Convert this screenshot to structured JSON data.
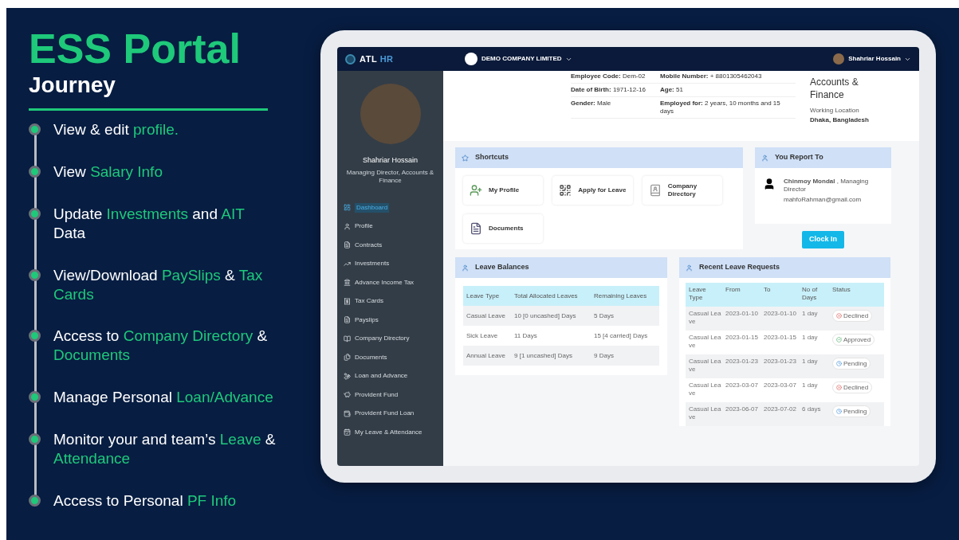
{
  "slide": {
    "title": "ESS Portal",
    "subtitle": "Journey"
  },
  "journey": [
    {
      "parts": [
        {
          "text": "View & edit ",
          "accent": false
        },
        {
          "text": "profile.",
          "accent": true
        }
      ]
    },
    {
      "parts": [
        {
          "text": "View ",
          "accent": false
        },
        {
          "text": "Salary Info",
          "accent": true
        }
      ]
    },
    {
      "parts": [
        {
          "text": "Update ",
          "accent": false
        },
        {
          "text": "Investments",
          "accent": true
        },
        {
          "text": " and ",
          "accent": false
        },
        {
          "text": "AIT",
          "accent": true
        },
        {
          "text": " Data",
          "accent": false
        }
      ]
    },
    {
      "parts": [
        {
          "text": "View/Download ",
          "accent": false
        },
        {
          "text": "PaySlips",
          "accent": true
        },
        {
          "text": " & ",
          "accent": false
        },
        {
          "text": "Tax Cards",
          "accent": true
        }
      ]
    },
    {
      "parts": [
        {
          "text": "Access to ",
          "accent": false
        },
        {
          "text": "Company Directory",
          "accent": true
        },
        {
          "text": " & ",
          "accent": false
        },
        {
          "text": "Documents",
          "accent": true
        }
      ]
    },
    {
      "parts": [
        {
          "text": "Manage Personal ",
          "accent": false
        },
        {
          "text": "Loan/Advance",
          "accent": true
        }
      ]
    },
    {
      "parts": [
        {
          "text": "Monitor your and team’s ",
          "accent": false
        },
        {
          "text": "Leave",
          "accent": true
        },
        {
          "text": " & ",
          "accent": false
        },
        {
          "text": "Attendance",
          "accent": true
        }
      ]
    },
    {
      "parts": [
        {
          "text": "Access to Personal ",
          "accent": false
        },
        {
          "text": "PF Info",
          "accent": true
        }
      ]
    }
  ],
  "app": {
    "logo": [
      {
        "text": "ATL ",
        "accent": false
      },
      {
        "text": "HR",
        "accent": true
      }
    ],
    "company": "DEMO COMPANY LIMITED",
    "user": "Shahriar Hossain",
    "sidebar": {
      "name": "Shahriar Hossain",
      "role": "Managing Director, Accounts & Finance",
      "items": [
        {
          "label": "Dashboard",
          "selected": true
        },
        {
          "label": "Profile",
          "selected": false
        },
        {
          "label": "Contracts",
          "selected": false
        },
        {
          "label": "Investments",
          "selected": false
        },
        {
          "label": "Advance Income Tax",
          "selected": false
        },
        {
          "label": "Tax Cards",
          "selected": false
        },
        {
          "label": "Payslips",
          "selected": false
        },
        {
          "label": "Company Directory",
          "selected": false
        },
        {
          "label": "Documents",
          "selected": false
        },
        {
          "label": "Loan and Advance",
          "selected": false
        },
        {
          "label": "Provident Fund",
          "selected": false
        },
        {
          "label": "Provident Fund Loan",
          "selected": false
        },
        {
          "label": "My Leave & Attendance",
          "selected": false
        }
      ]
    },
    "profile": {
      "fields": [
        {
          "label": "Employee Code:",
          "value": "Dem-02"
        },
        {
          "label": "Mobile Number:",
          "value": "+ 8801305462043"
        },
        {
          "label": "Date of Birth:",
          "value": "1971-12-16"
        },
        {
          "label": "Age:",
          "value": "51"
        },
        {
          "label": "Gender:",
          "value": "Male"
        },
        {
          "label": "Employed for:",
          "value": "2 years, 10 months and 15 days"
        }
      ],
      "department": "Accounts & Finance",
      "location_label": "Working Location",
      "location": "Dhaka, Bangladesh"
    },
    "shortcuts": {
      "title": "Shortcuts",
      "items": [
        "My Profile",
        "Apply for Leave",
        "Company Directory",
        "Documents"
      ]
    },
    "report_to": {
      "title": "You Report To",
      "name": "Chinmoy Mondal",
      "role": ", Managing Director",
      "email": "mahfoRahman@gmail.com"
    },
    "clock_in": "Clock In",
    "leave_balances": {
      "title": "Leave Balances",
      "columns": [
        "Leave Type",
        "Total Allocated Leaves",
        "Remaining Leaves"
      ],
      "rows": [
        [
          "Casual Leave",
          "10 [0 uncashed] Days",
          "5 Days"
        ],
        [
          "Sick Leave",
          "11 Days",
          "15 [4 carried] Days"
        ],
        [
          "Annual Leave",
          "9 [1 uncashed] Days",
          "9 Days"
        ]
      ]
    },
    "recent_requests": {
      "title": "Recent Leave Requests",
      "columns": [
        "Leave Type",
        "From",
        "To",
        "No of Days",
        "Status"
      ],
      "rows": [
        {
          "cells": [
            "Casual Leave",
            "2023-01-10",
            "2023-01-10",
            "1 day"
          ],
          "status": {
            "label": "Declined",
            "kind": "declined"
          }
        },
        {
          "cells": [
            "Casual Leave",
            "2023-01-15",
            "2023-01-15",
            "1 day"
          ],
          "status": {
            "label": "Approved",
            "kind": "approved"
          }
        },
        {
          "cells": [
            "Casual Leave",
            "2023-01-23",
            "2023-01-23",
            "1 day"
          ],
          "status": {
            "label": "Pending",
            "kind": "pending"
          }
        },
        {
          "cells": [
            "Casual Leave",
            "2023-03-07",
            "2023-03-07",
            "1 day"
          ],
          "status": {
            "label": "Declined",
            "kind": "declined"
          }
        },
        {
          "cells": [
            "Casual Leave",
            "2023-06-07",
            "2023-07-02",
            "6 days"
          ],
          "status": {
            "label": "Pending",
            "kind": "pending"
          }
        }
      ]
    }
  }
}
